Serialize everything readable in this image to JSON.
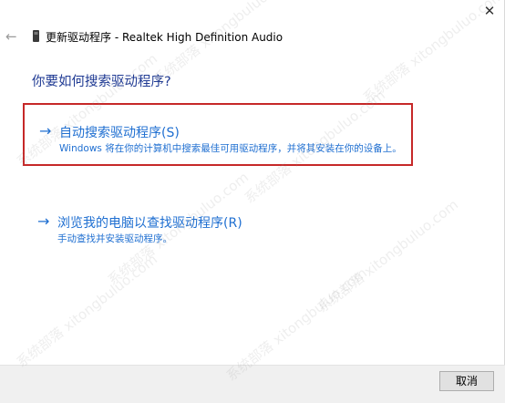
{
  "window": {
    "close_glyph": "✕",
    "back_glyph": "←",
    "title": "更新驱动程序 - Realtek High Definition Audio"
  },
  "main": {
    "heading": "你要如何搜索驱动程序?",
    "options": [
      {
        "arrow": "→",
        "title": "自动搜索驱动程序(S)",
        "description": "Windows 将在你的计算机中搜索最佳可用驱动程序，并将其安装在你的设备上。"
      },
      {
        "arrow": "→",
        "title": "浏览我的电脑以查找驱动程序(R)",
        "description": "手动查找并安装驱动程序。"
      }
    ]
  },
  "footer": {
    "cancel_label": "取消"
  },
  "watermark": {
    "text": "系统部落 xitongbuluo.com"
  },
  "colors": {
    "link_blue": "#1f6fd1",
    "heading_blue": "#1f3a93",
    "highlight_red": "#c62828",
    "footer_bg": "#f0f0f0"
  }
}
